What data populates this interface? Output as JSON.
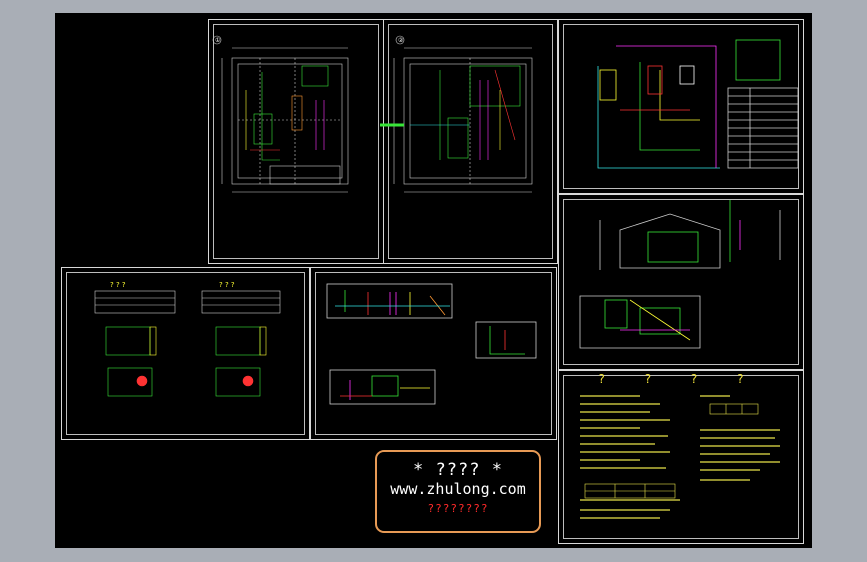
{
  "watermark": {
    "title": "* ???? *",
    "url": "www.zhulong.com",
    "subtitle": "????????"
  },
  "notes_heading": "? ? ? ?",
  "sheets": [
    {
      "id": "plan-1",
      "label": "①"
    },
    {
      "id": "plan-2",
      "label": "②"
    },
    {
      "id": "system-diagram"
    },
    {
      "id": "sections"
    },
    {
      "id": "equipment-tables",
      "table_titles": [
        "? ? ?",
        "? ? ?"
      ]
    },
    {
      "id": "piping-elevations"
    },
    {
      "id": "design-notes"
    }
  ],
  "colors": {
    "background": "#000000",
    "frame": "#d8d8d8",
    "pipe_green": "#39e639",
    "pipe_magenta": "#ff33ff",
    "pipe_yellow": "#ffff33",
    "pipe_red": "#ff3333",
    "pipe_cyan": "#33e6e6",
    "pipe_orange": "#ff9933",
    "text_yellow": "#e8e24a",
    "watermark_border": "#e79a55",
    "watermark_red": "#ff2a2a",
    "desktop": "#a9aeb6"
  }
}
